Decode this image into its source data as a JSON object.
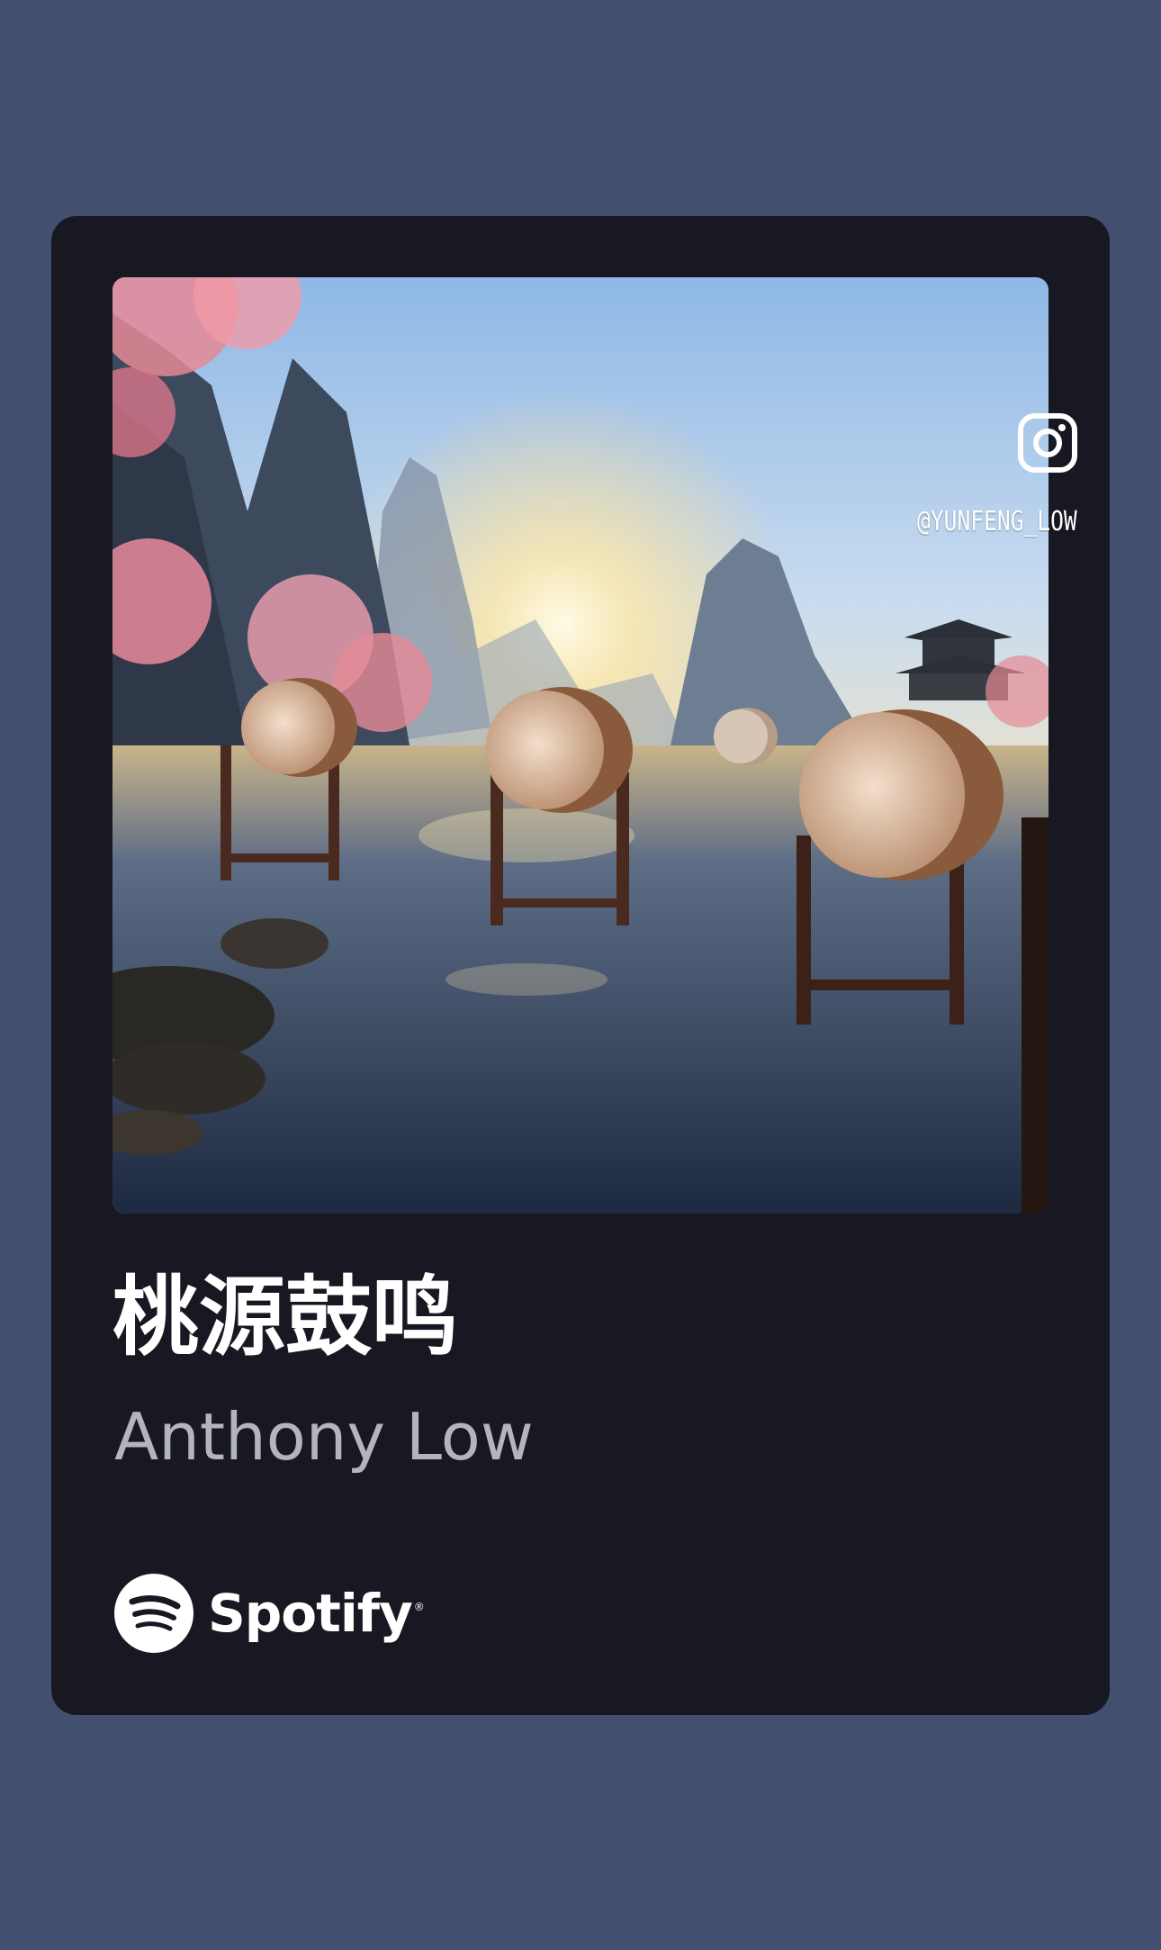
{
  "track": {
    "title": "桃源鼓鸣",
    "artist": "Anthony Low"
  },
  "artwork": {
    "description_icon": "album-artwork"
  },
  "brand": {
    "name": "Spotify",
    "trademark": "®",
    "icon": "spotify-logo-icon"
  },
  "watermark": {
    "icon": "instagram-icon",
    "handle": "@YUNFENG_LOW"
  },
  "colors": {
    "background": "#434f6e",
    "card": "#171822",
    "title": "#ffffff",
    "artist": "#b4b5bc"
  }
}
